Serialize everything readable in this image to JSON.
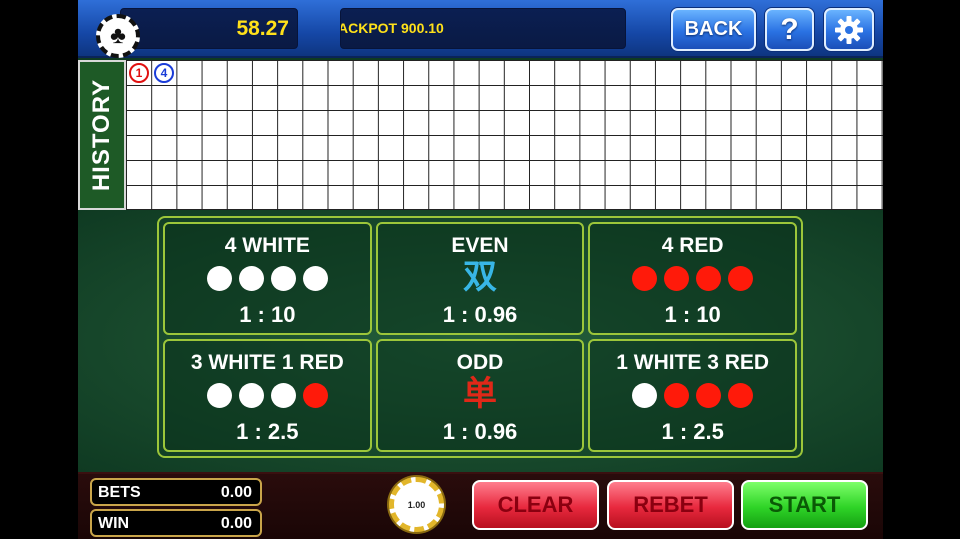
{
  "topbar": {
    "balance": "58.27",
    "jackpot": "ACKPOT 900.10",
    "back_label": "BACK",
    "help_label": "?"
  },
  "history": {
    "label": "HISTORY",
    "marks": [
      {
        "value": "1",
        "color": "#e01010"
      },
      {
        "value": "4",
        "color": "#1a3cd8"
      }
    ]
  },
  "bets": [
    {
      "title": "4 WHITE",
      "odds": "1 : 10",
      "balls": [
        "white",
        "white",
        "white",
        "white"
      ]
    },
    {
      "title": "EVEN",
      "odds": "1 : 0.96",
      "glyph": "双",
      "glyph_color": "#38b6e6"
    },
    {
      "title": "4 RED",
      "odds": "1 : 10",
      "balls": [
        "red",
        "red",
        "red",
        "red"
      ]
    },
    {
      "title": "3 WHITE 1 RED",
      "odds": "1 : 2.5",
      "balls": [
        "white",
        "white",
        "white",
        "red"
      ]
    },
    {
      "title": "ODD",
      "odds": "1 : 0.96",
      "glyph": "单",
      "glyph_color": "#e02818"
    },
    {
      "title": "1 WHITE 3 RED",
      "odds": "1 : 2.5",
      "balls": [
        "white",
        "red",
        "red",
        "red"
      ]
    }
  ],
  "bottombar": {
    "bets_label": "BETS",
    "bets_value": "0.00",
    "win_label": "WIN",
    "win_value": "0.00",
    "chip_value": "1.00",
    "clear_label": "CLEAR",
    "rebet_label": "REBET",
    "start_label": "START"
  },
  "colors": {
    "accent_blue": "#1547a6",
    "board_border": "#9cc63a",
    "felt_green": "#18492c",
    "ball_red": "#ff1a0a",
    "balance_yellow": "#ffe11a"
  }
}
